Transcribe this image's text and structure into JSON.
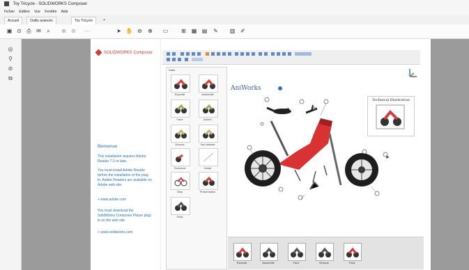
{
  "window": {
    "title": "Toy Tricycle - SOLIDWORKS Composer",
    "menu": [
      "Fichier",
      "Edition",
      "Vue",
      "Fenêtre",
      "Aide"
    ]
  },
  "tabs": [
    {
      "label": "Accueil"
    },
    {
      "label": "Outils avancés"
    },
    {
      "label": "Toy Tricycle"
    },
    {
      "label": "+"
    }
  ],
  "document": {
    "brand": "SOLIDWORKS Composer",
    "welcome_title": "Bienvenue",
    "para1": "This installation requires Adobe Reader 7.0 or later.",
    "para2": "You must install Adobe Reader before the installation of the plug-in. Adobe Readers are available on Adobe web site:",
    "link1": "+ www.adobe.com",
    "para3": "You must download the SolidWorks Composer Player plug-in on the web site.",
    "link2": "+ www.solidworks.com"
  },
  "viewer": {
    "views_header": "Vues",
    "views": [
      {
        "label": "Explodé"
      },
      {
        "label": "Assemblé"
      },
      {
        "label": "Face"
      },
      {
        "label": "Arrière"
      },
      {
        "label": "Dessus"
      },
      {
        "label": "Vue latérale"
      },
      {
        "label": "Technical"
      },
      {
        "label": "Detail"
      },
      {
        "label": "Step"
      },
      {
        "label": "Presentation"
      },
      {
        "label": "Final"
      }
    ],
    "brand": "AniWorks",
    "illustration_title": "Technical Illustration",
    "bottom_views": [
      {
        "label": "Explodé"
      },
      {
        "label": "Assemblé"
      },
      {
        "label": "Face"
      },
      {
        "label": "Dessus"
      },
      {
        "label": "Final"
      }
    ]
  },
  "colors": {
    "accent_red": "#d43b3b",
    "link_blue": "#2b6fb3",
    "panel_gray": "#9b9b9b"
  }
}
